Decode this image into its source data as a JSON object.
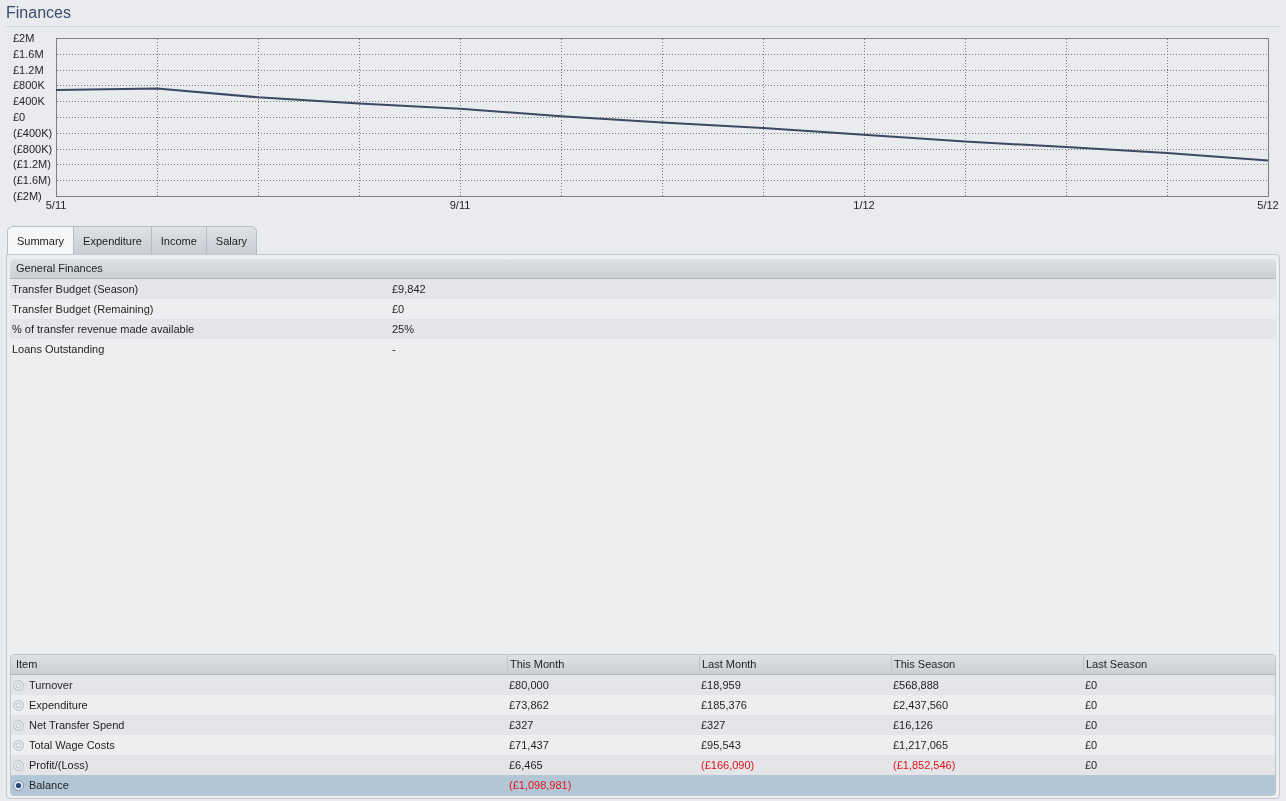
{
  "title": "Finances",
  "balance_chart": {
    "chart_data": {
      "type": "line",
      "categories": [
        "5/11",
        null,
        null,
        null,
        "9/11",
        null,
        null,
        null,
        "1/12",
        null,
        null,
        null,
        "5/12"
      ],
      "ylim": [
        -2000000,
        2000000
      ],
      "yticks": [
        {
          "value": 2000000,
          "label": "£2M"
        },
        {
          "value": 1600000,
          "label": "£1.6M"
        },
        {
          "value": 1200000,
          "label": "£1.2M"
        },
        {
          "value": 800000,
          "label": "£800K"
        },
        {
          "value": 400000,
          "label": "£400K"
        },
        {
          "value": 0,
          "label": "£0"
        },
        {
          "value": -400000,
          "label": "(£400K)"
        },
        {
          "value": -800000,
          "label": "(£800K)"
        },
        {
          "value": -1200000,
          "label": "(£1.2M)"
        },
        {
          "value": -1600000,
          "label": "(£1.6M)"
        },
        {
          "value": -2000000,
          "label": "(£2M)"
        }
      ],
      "grid": true,
      "series": [
        {
          "color": "#3b4a63",
          "values": [
            680000,
            720000,
            500000,
            340000,
            210000,
            20000,
            -140000,
            -280000,
            -450000,
            -620000,
            -760000,
            -910000,
            -1100000
          ]
        }
      ]
    }
  },
  "tabs": [
    {
      "label": "Summary",
      "selected": true
    },
    {
      "label": "Expenditure",
      "selected": false
    },
    {
      "label": "Income",
      "selected": false
    },
    {
      "label": "Salary",
      "selected": false
    }
  ],
  "general_finances": {
    "title": "General Finances",
    "rows": [
      {
        "label": "Transfer Budget (Season)",
        "value": "£9,842"
      },
      {
        "label": "Transfer Budget (Remaining)",
        "value": "£0"
      },
      {
        "label": "% of transfer revenue made available",
        "value": "25%"
      },
      {
        "label": "Loans Outstanding",
        "value": "-"
      }
    ]
  },
  "summary_table": {
    "columns": [
      "Item",
      "This Month",
      "Last Month",
      "This Season",
      "Last Season"
    ],
    "rows": [
      {
        "selected": false,
        "cells": [
          {
            "text": "Turnover",
            "negative": false
          },
          {
            "text": "£80,000",
            "negative": false
          },
          {
            "text": "£18,959",
            "negative": false
          },
          {
            "text": "£568,888",
            "negative": false
          },
          {
            "text": "£0",
            "negative": false
          }
        ]
      },
      {
        "selected": false,
        "cells": [
          {
            "text": "Expenditure",
            "negative": false
          },
          {
            "text": "£73,862",
            "negative": false
          },
          {
            "text": "£185,376",
            "negative": false
          },
          {
            "text": "£2,437,560",
            "negative": false
          },
          {
            "text": "£0",
            "negative": false
          }
        ]
      },
      {
        "selected": false,
        "cells": [
          {
            "text": "Net Transfer Spend",
            "negative": false
          },
          {
            "text": "£327",
            "negative": false
          },
          {
            "text": "£327",
            "negative": false
          },
          {
            "text": "£16,126",
            "negative": false
          },
          {
            "text": "£0",
            "negative": false
          }
        ]
      },
      {
        "selected": false,
        "cells": [
          {
            "text": "Total Wage Costs",
            "negative": false
          },
          {
            "text": "£71,437",
            "negative": false
          },
          {
            "text": "£95,543",
            "negative": false
          },
          {
            "text": "£1,217,065",
            "negative": false
          },
          {
            "text": "£0",
            "negative": false
          }
        ]
      },
      {
        "selected": false,
        "cells": [
          {
            "text": "Profit/(Loss)",
            "negative": false
          },
          {
            "text": "£6,465",
            "negative": false
          },
          {
            "text": "(£166,090)",
            "negative": true
          },
          {
            "text": "(£1,852,546)",
            "negative": true
          },
          {
            "text": "£0",
            "negative": false
          }
        ]
      },
      {
        "selected": true,
        "cells": [
          {
            "text": "Balance",
            "negative": false
          },
          {
            "text": "(£1,098,981)",
            "negative": true
          }
        ]
      }
    ]
  }
}
